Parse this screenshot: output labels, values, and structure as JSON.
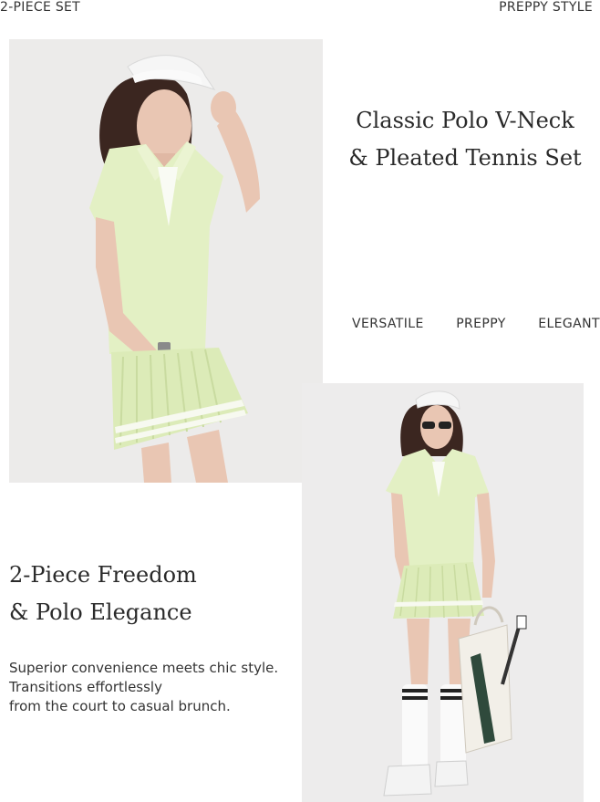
{
  "header": {
    "left_label": "2-PIECE SET",
    "right_label": "PREPPY STYLE"
  },
  "hero": {
    "title_line1": "Classic Polo V-Neck",
    "title_line2": "& Pleated Tennis Set"
  },
  "tags": [
    "VERSATILE",
    "PREPPY",
    "ELEGANT"
  ],
  "feature": {
    "title_line1": "2-Piece Freedom",
    "title_line2": "& Polo Elegance",
    "description": [
      "Superior convenience meets chic style.",
      "Transitions effortlessly",
      "from the court to casual brunch."
    ]
  },
  "colors": {
    "outfit": "#e3f0c4",
    "visor": "#f4f4f4",
    "background": "#ffffff",
    "photo_bg": "#eceaea"
  }
}
